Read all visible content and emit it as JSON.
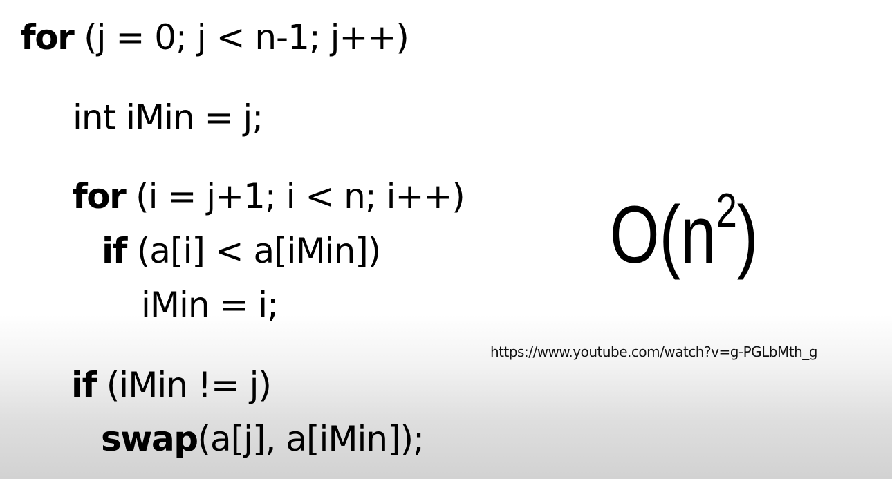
{
  "code": {
    "line1": {
      "keyword": "for",
      "rest": " (j = 0; j < n-1; j++)"
    },
    "line2": {
      "text": "int iMin = j;"
    },
    "line3": {
      "keyword": "for",
      "rest": " (i = j+1; i < n; i++)"
    },
    "line4": {
      "keyword": "if",
      "rest": " (a[i] < a[iMin])"
    },
    "line5": {
      "text": "iMin = i;"
    },
    "line6": {
      "keyword": "if",
      "rest": " (iMin != j)"
    },
    "line7": {
      "keyword": "swap",
      "rest": "(a[j], a[iMin]);"
    }
  },
  "complexity": {
    "base": "O(n",
    "exponent": "2",
    "close": ")"
  },
  "source_url": "https://www.youtube.com/watch?v=g-PGLbMth_g"
}
